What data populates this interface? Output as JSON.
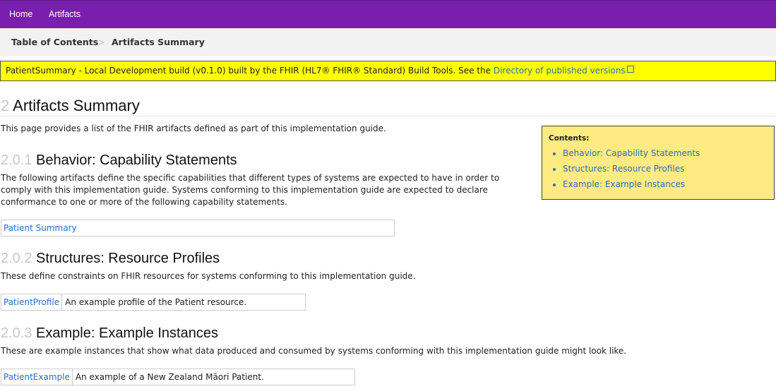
{
  "nav": {
    "home": "Home",
    "artifacts": "Artifacts"
  },
  "breadcrumb": {
    "toc": "Table of Contents",
    "separator": ">",
    "current": "Artifacts Summary"
  },
  "notice": {
    "text": "PatientSummary - Local Development build (v0.1.0) built by the FHIR (HL7® FHIR® Standard) Build Tools. See the ",
    "link": "Directory of published versions"
  },
  "page": {
    "number": "2",
    "title": "Artifacts Summary",
    "intro": "This page provides a list of the FHIR artifacts defined as part of this implementation guide."
  },
  "sections": [
    {
      "number": "2.0.1",
      "title": "Behavior: Capability Statements",
      "description": "The following artifacts define the specific capabilities that different types of systems are expected to have in order to comply with this implementation guide. Systems conforming to this implementation guide are expected to declare conformance to one or more of the following capability statements.",
      "rows": [
        {
          "name": "Patient Summary",
          "desc": ""
        }
      ]
    },
    {
      "number": "2.0.2",
      "title": "Structures: Resource Profiles",
      "description": "These define constraints on FHIR resources for systems conforming to this implementation guide.",
      "rows": [
        {
          "name": "PatientProfile",
          "desc": "An example profile of the Patient resource."
        }
      ]
    },
    {
      "number": "2.0.3",
      "title": "Example: Example Instances",
      "description": "These are example instances that show what data produced and consumed by systems conforming with this implementation guide might look like.",
      "rows": [
        {
          "name": "PatientExample",
          "desc": "An example of a New Zealand Māori Patient."
        }
      ]
    }
  ],
  "toc": {
    "title": "Contents:",
    "items": [
      "Behavior: Capability Statements",
      "Structures: Resource Profiles",
      "Example: Example Instances"
    ]
  },
  "colors": {
    "nav_bg": "#7a1fad",
    "notice_bg": "#ffff00",
    "toc_bg": "#ffeb82",
    "link": "#2a6ebb"
  }
}
